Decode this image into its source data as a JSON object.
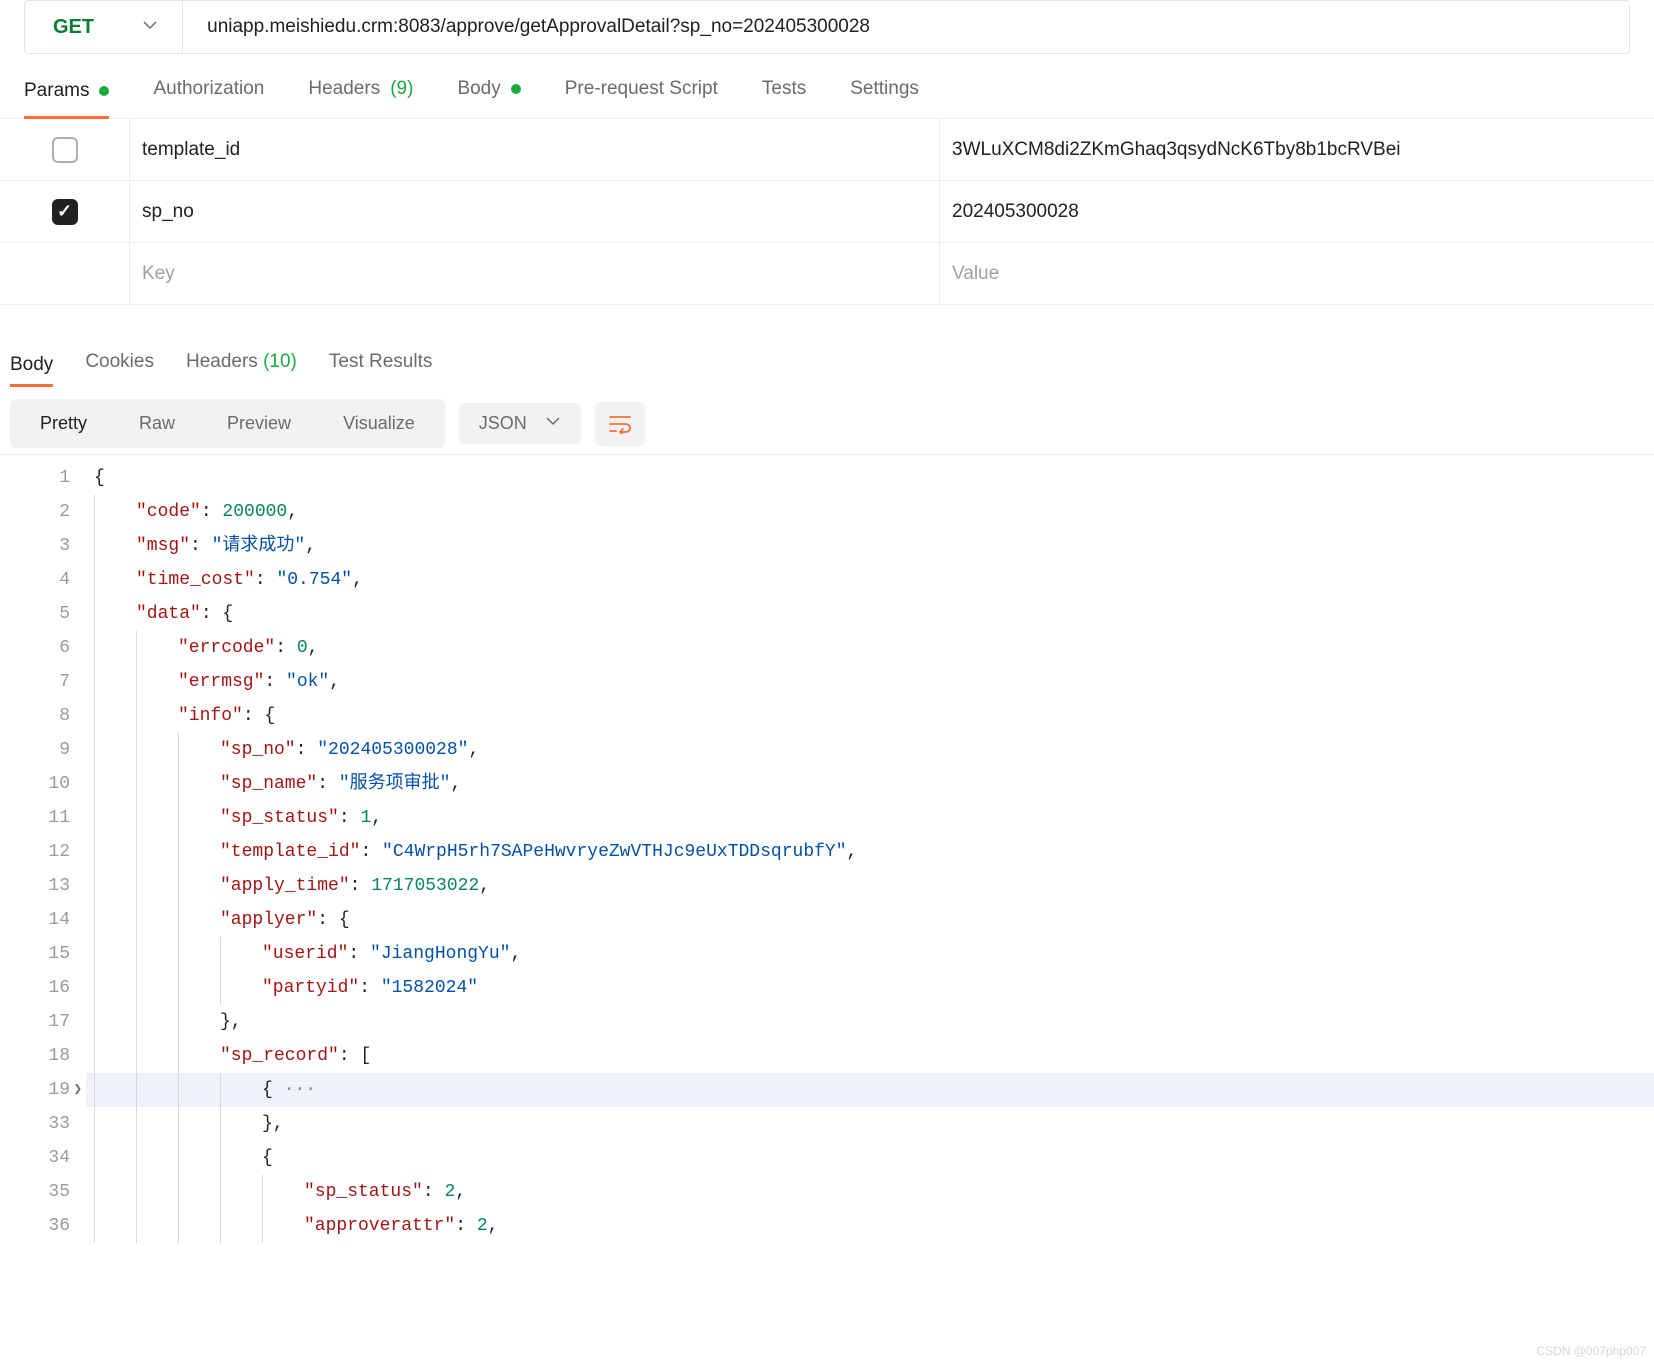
{
  "request": {
    "method": "GET",
    "url": "uniapp.meishiedu.crm:8083/approve/getApprovalDetail?sp_no=202405300028"
  },
  "req_tabs": {
    "params": "Params",
    "authorization": "Authorization",
    "headers": "Headers",
    "headers_count": "(9)",
    "body": "Body",
    "prerequest": "Pre-request Script",
    "tests": "Tests",
    "settings": "Settings"
  },
  "params": {
    "rows": [
      {
        "checked": false,
        "key": "template_id",
        "value": "3WLuXCM8di2ZKmGhaq3qsydNcK6Tby8b1bcRVBei"
      },
      {
        "checked": true,
        "key": "sp_no",
        "value": "202405300028"
      }
    ],
    "key_placeholder": "Key",
    "value_placeholder": "Value"
  },
  "resp_tabs": {
    "body": "Body",
    "cookies": "Cookies",
    "headers": "Headers",
    "headers_count": "(10)",
    "test_results": "Test Results"
  },
  "view_group": {
    "pretty": "Pretty",
    "raw": "Raw",
    "preview": "Preview",
    "visualize": "Visualize"
  },
  "type_select": {
    "label": "JSON"
  },
  "json_response": {
    "code": 200000,
    "msg": "请求成功",
    "time_cost": "0.754",
    "data": {
      "errcode": 0,
      "errmsg": "ok",
      "info": {
        "sp_no": "202405300028",
        "sp_name": "服务项审批",
        "sp_status": 1,
        "template_id": "C4WrpH5rh7SAPeHwvryeZwVTHJc9eUxTDDsqrubfY",
        "apply_time": 1717053022,
        "applyer": {
          "userid": "JiangHongYu",
          "partyid": "1582024"
        },
        "sp_record": [
          {
            "_collapsed": true
          },
          {
            "sp_status": 2,
            "approverattr": 2
          }
        ]
      }
    }
  },
  "gutter_lines": [
    "1",
    "2",
    "3",
    "4",
    "5",
    "6",
    "7",
    "8",
    "9",
    "10",
    "11",
    "12",
    "13",
    "14",
    "15",
    "16",
    "17",
    "18",
    "19",
    "33",
    "34",
    "35",
    "36"
  ],
  "code_lines": [
    {
      "indent": 0,
      "html": "<span class='p'>{</span>"
    },
    {
      "indent": 1,
      "html": "<span class='k'>\"code\"</span><span class='p'>: </span><span class='n'>200000</span><span class='p'>,</span>"
    },
    {
      "indent": 1,
      "html": "<span class='k'>\"msg\"</span><span class='p'>: </span><span class='s'>\"请求成功\"</span><span class='p'>,</span>"
    },
    {
      "indent": 1,
      "html": "<span class='k'>\"time_cost\"</span><span class='p'>: </span><span class='s'>\"0.754\"</span><span class='p'>,</span>"
    },
    {
      "indent": 1,
      "html": "<span class='k'>\"data\"</span><span class='p'>: {</span>"
    },
    {
      "indent": 2,
      "html": "<span class='k'>\"errcode\"</span><span class='p'>: </span><span class='n'>0</span><span class='p'>,</span>"
    },
    {
      "indent": 2,
      "html": "<span class='k'>\"errmsg\"</span><span class='p'>: </span><span class='s'>\"ok\"</span><span class='p'>,</span>"
    },
    {
      "indent": 2,
      "html": "<span class='k'>\"info\"</span><span class='p'>: {</span>"
    },
    {
      "indent": 3,
      "html": "<span class='k'>\"sp_no\"</span><span class='p'>: </span><span class='s'>\"202405300028\"</span><span class='p'>,</span>"
    },
    {
      "indent": 3,
      "html": "<span class='k'>\"sp_name\"</span><span class='p'>: </span><span class='s'>\"服务项审批\"</span><span class='p'>,</span>"
    },
    {
      "indent": 3,
      "html": "<span class='k'>\"sp_status\"</span><span class='p'>: </span><span class='n'>1</span><span class='p'>,</span>"
    },
    {
      "indent": 3,
      "html": "<span class='k'>\"template_id\"</span><span class='p'>: </span><span class='s'>\"C4WrpH5rh7SAPeHwvryeZwVTHJc9eUxTDDsqrubfY\"</span><span class='p'>,</span>"
    },
    {
      "indent": 3,
      "html": "<span class='k'>\"apply_time\"</span><span class='p'>: </span><span class='n'>1717053022</span><span class='p'>,</span>"
    },
    {
      "indent": 3,
      "html": "<span class='k'>\"applyer\"</span><span class='p'>: {</span>"
    },
    {
      "indent": 4,
      "html": "<span class='k'>\"userid\"</span><span class='p'>: </span><span class='s'>\"JiangHongYu\"</span><span class='p'>,</span>"
    },
    {
      "indent": 4,
      "html": "<span class='k'>\"partyid\"</span><span class='p'>: </span><span class='s'>\"1582024\"</span>"
    },
    {
      "indent": 3,
      "html": "<span class='p'>},</span>"
    },
    {
      "indent": 3,
      "html": "<span class='k'>\"sp_record\"</span><span class='p'>: [</span>"
    },
    {
      "indent": 4,
      "html": "<span class='p'>{</span><span class='dots'> ···</span>",
      "hl": true
    },
    {
      "indent": 4,
      "html": "<span class='p'>},</span>"
    },
    {
      "indent": 4,
      "html": "<span class='p'>{</span>"
    },
    {
      "indent": 5,
      "html": "<span class='k'>\"sp_status\"</span><span class='p'>: </span><span class='n'>2</span><span class='p'>,</span>"
    },
    {
      "indent": 5,
      "html": "<span class='k'>\"approverattr\"</span><span class='p'>: </span><span class='n'>2</span><span class='p'>,</span>"
    }
  ],
  "watermark": "CSDN @007php007"
}
